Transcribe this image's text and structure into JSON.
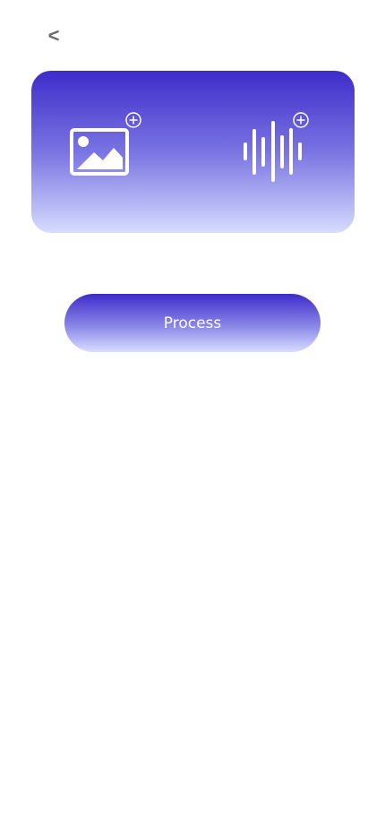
{
  "nav": {
    "back_label": "<"
  },
  "upload": {
    "image_icon": "image-add-icon",
    "audio_icon": "audio-waveform-add-icon"
  },
  "actions": {
    "process_label": "Process"
  },
  "colors": {
    "gradient_top": "#3d2ccb",
    "gradient_bottom": "#d6dcff",
    "back_text": "#6b6b6b",
    "icon": "#ffffff"
  }
}
